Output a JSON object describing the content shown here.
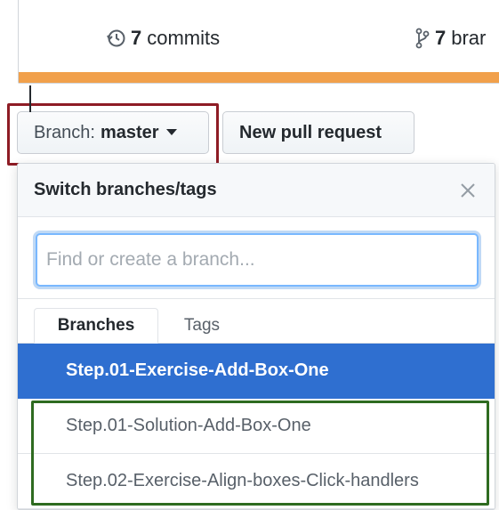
{
  "summary": {
    "commits_count": "7",
    "commits_label": "commits",
    "branches_count": "7",
    "branches_label": "brar",
    "language_bar_color": "#f1a04b"
  },
  "toolbar": {
    "branch_prefix": "Branch:",
    "branch_value": "master",
    "new_pull_request_label": "New pull request"
  },
  "dropdown": {
    "title": "Switch branches/tags",
    "filter_placeholder": "Find or create a branch...",
    "tabs": [
      "Branches",
      "Tags"
    ],
    "items": [
      {
        "label": "Step.01-Exercise-Add-Box-One",
        "selected": true
      },
      {
        "label": "Step.01-Solution-Add-Box-One",
        "selected": false
      },
      {
        "label": "Step.02-Exercise-Align-boxes-Click-handlers",
        "selected": false
      }
    ]
  },
  "colors": {
    "selected_bg": "#2f6fd0",
    "red_highlight": "#8e1c25",
    "green_highlight": "#2e6b20",
    "focus_ring": "#79b8ff"
  },
  "icons": {
    "commits": "history-icon",
    "branches": "git-branch-icon",
    "caret": "caret-down-icon",
    "close": "close-icon"
  }
}
